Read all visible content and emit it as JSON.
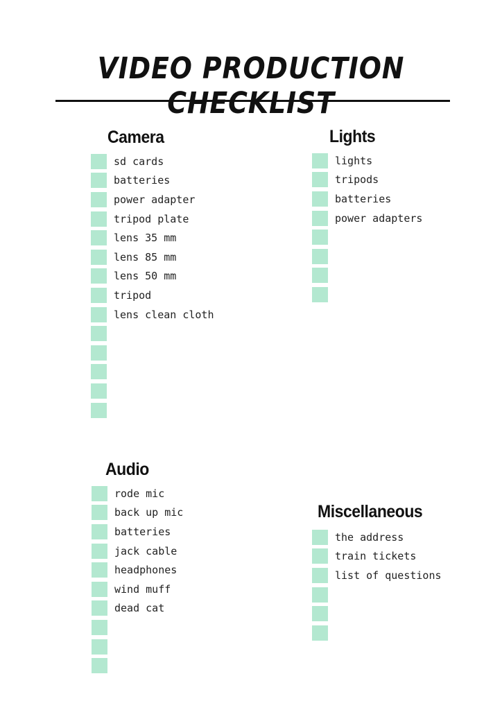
{
  "title": "VIDEO PRODUCTION CHECKLIST",
  "colors": {
    "checkbox": "#b3e8d0",
    "text": "#111111"
  },
  "sections": [
    {
      "id": "camera",
      "heading": "Camera",
      "items": [
        "sd cards",
        "batteries",
        "power adapter",
        "tripod plate",
        "lens 35 mm",
        "lens 85 mm",
        "lens 50 mm",
        "tripod",
        "lens clean cloth",
        "",
        "",
        "",
        "",
        ""
      ]
    },
    {
      "id": "lights",
      "heading": "Lights",
      "items": [
        "lights",
        "tripods",
        "batteries",
        "power adapters",
        "",
        "",
        "",
        ""
      ]
    },
    {
      "id": "audio",
      "heading": "Audio",
      "items": [
        "rode mic",
        "back up mic",
        "batteries",
        "jack cable",
        "headphones",
        "wind muff",
        "dead cat",
        "",
        "",
        ""
      ]
    },
    {
      "id": "misc",
      "heading": "Miscellaneous",
      "items": [
        "the address",
        "train tickets",
        "list of questions",
        "",
        "",
        ""
      ]
    }
  ]
}
